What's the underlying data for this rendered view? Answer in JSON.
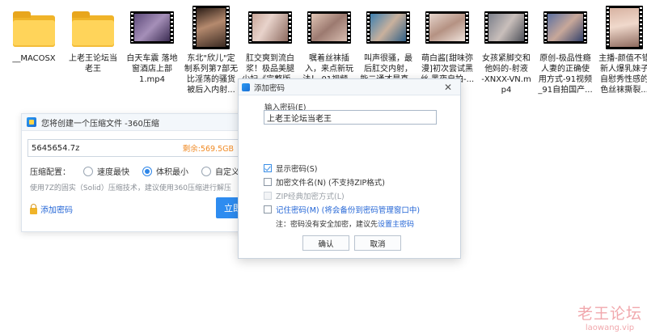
{
  "files": [
    {
      "name": "__MACOSX",
      "type": "folder"
    },
    {
      "name": "上老王论坛当\n老王",
      "type": "folder"
    },
    {
      "name": "白天车震 落地\n窗酒店上部\n1.mp4",
      "type": "video"
    },
    {
      "name": "东北\"欣儿\"定\n制系列第7部无\n比淫荡的骚货\n被后入内射...",
      "type": "video"
    },
    {
      "name": "肛交爽到流白\n浆！极品美腿\n少妇《完整版...",
      "type": "video"
    },
    {
      "name": "嘱着丝袜插\n入，来点新玩\n法！ 01视频...",
      "type": "video"
    },
    {
      "name": "叫声很骚，最\n后肛交内射，\n能二通才是真...",
      "type": "video"
    },
    {
      "name": "萌白酱[甜味弥\n漫]初次尝试黑\n丝 黑夜自拍-...",
      "type": "video"
    },
    {
      "name": "女孩紧脚交和\n他妈的-射液\n-XNXX-VN.m\np4",
      "type": "video"
    },
    {
      "name": "原创-极品性瘾\n人妻的正确使\n用方式-91视频\n_91自拍国产...",
      "type": "video"
    },
    {
      "name": "主播-颜值不错\n新人爆乳妹子\n自慰秀性感的\n色丝袜撕裂...",
      "type": "video"
    }
  ],
  "zip_window": {
    "title": "您将创建一个压缩文件 -360压缩",
    "path_value": "5645654.7z",
    "free_space": "剩余:569.5GB",
    "config_label": "压缩配置：",
    "options": [
      "速度最快",
      "体积最小",
      "自定义"
    ],
    "selected_option": "体积最小",
    "hint": "使用7Z的固实（Solid）压缩技术，建议使用360压缩进行解压",
    "add_password": "添加密码",
    "start_button": "立即压缩"
  },
  "password_dialog": {
    "title": "添加密码",
    "close": "✕",
    "input_label": "输入密码(E)",
    "password_value": "上老王论坛当老王",
    "show_password": "显示密码(S)",
    "show_password_checked": true,
    "encrypt_filenames": "加密文件名(N) (不支持ZIP格式)",
    "encrypt_filenames_checked": false,
    "zip_classic": "ZIP经典加密方式(L)",
    "zip_classic_enabled": false,
    "remember_password": "记住密码(M) (将会备份到密码管理窗口中)",
    "remember_checked": false,
    "note_prefix": "注：密码没有安全加密，建议先",
    "note_link": "设置主密码",
    "ok": "确认",
    "cancel": "取消"
  },
  "watermark": {
    "title": "老王论坛",
    "url": "laowang.vip"
  },
  "colors": {
    "accent": "#2e8cf0",
    "folder": "#ffd45a",
    "free_space": "#f08a24",
    "watermark": "#f1a8ad"
  }
}
